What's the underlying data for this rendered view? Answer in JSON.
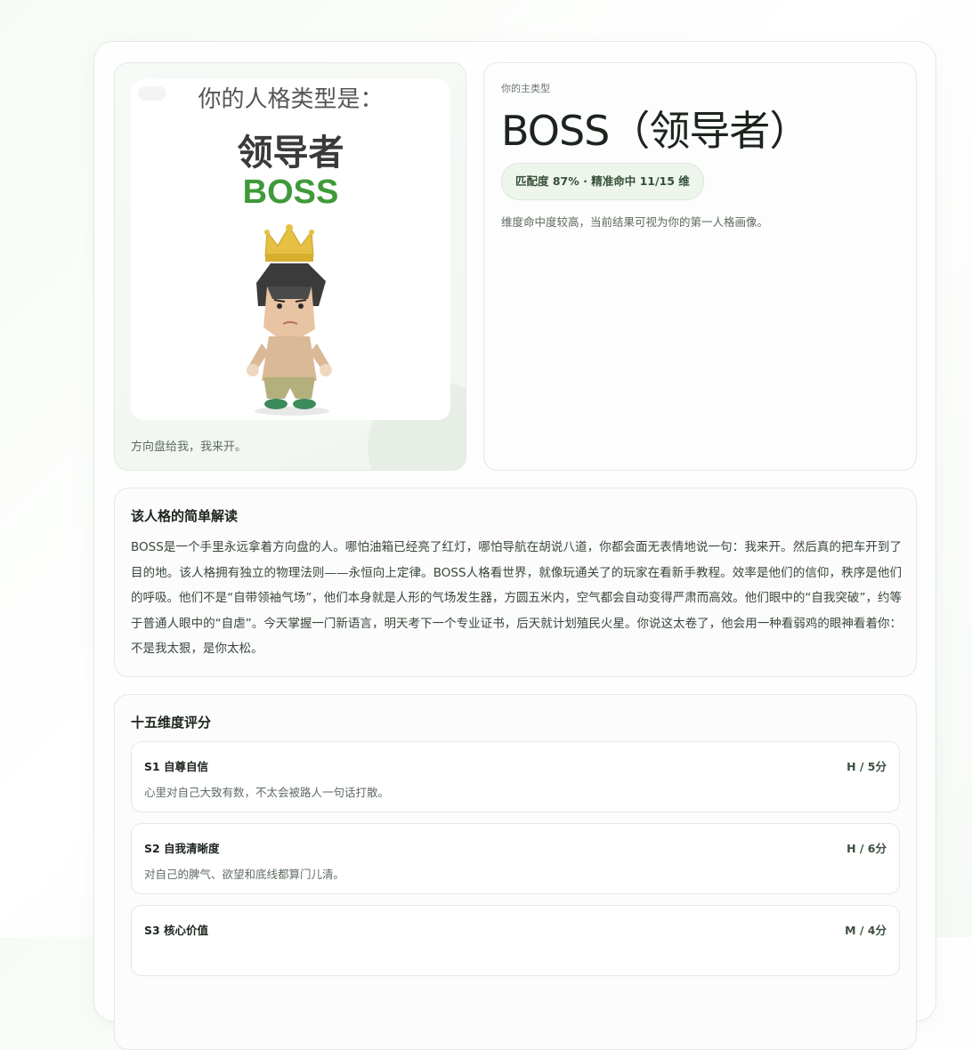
{
  "poster": {
    "heading": "你的人格类型是：",
    "type_cn": "领导者",
    "type_en": "BOSS",
    "quote": "方向盘给我，我来开。"
  },
  "summary": {
    "eyebrow": "你的主类型",
    "title": "BOSS（领导者）",
    "match_badge": "匹配度 87% · 精准命中 11/15 维",
    "description": "维度命中度较高，当前结果可视为你的第一人格画像。"
  },
  "interpretation": {
    "title": "该人格的简单解读",
    "body": "BOSS是一个手里永远拿着方向盘的人。哪怕油箱已经亮了红灯，哪怕导航在胡说八道，你都会面无表情地说一句：我来开。然后真的把车开到了目的地。该人格拥有独立的物理法则——永恒向上定律。BOSS人格看世界，就像玩通关了的玩家在看新手教程。效率是他们的信仰，秩序是他们的呼吸。他们不是“自带领袖气场”，他们本身就是人形的气场发生器，方圆五米内，空气都会自动变得严肃而高效。他们眼中的“自我突破”，约等于普通人眼中的“自虐”。今天掌握一门新语言，明天考下一个专业证书，后天就计划殖民火星。你说这太卷了，他会用一种看弱鸡的眼神看着你：不是我太狠，是你太松。"
  },
  "dimensions": {
    "title": "十五维度评分",
    "items": [
      {
        "name": "S1 自尊自信",
        "score": "H / 5分",
        "desc": "心里对自己大致有数，不太会被路人一句话打散。"
      },
      {
        "name": "S2 自我清晰度",
        "score": "H / 6分",
        "desc": "对自己的脾气、欲望和底线都算门儿清。"
      },
      {
        "name": "S3 核心价值",
        "score": "M / 4分",
        "desc": ""
      }
    ]
  }
}
